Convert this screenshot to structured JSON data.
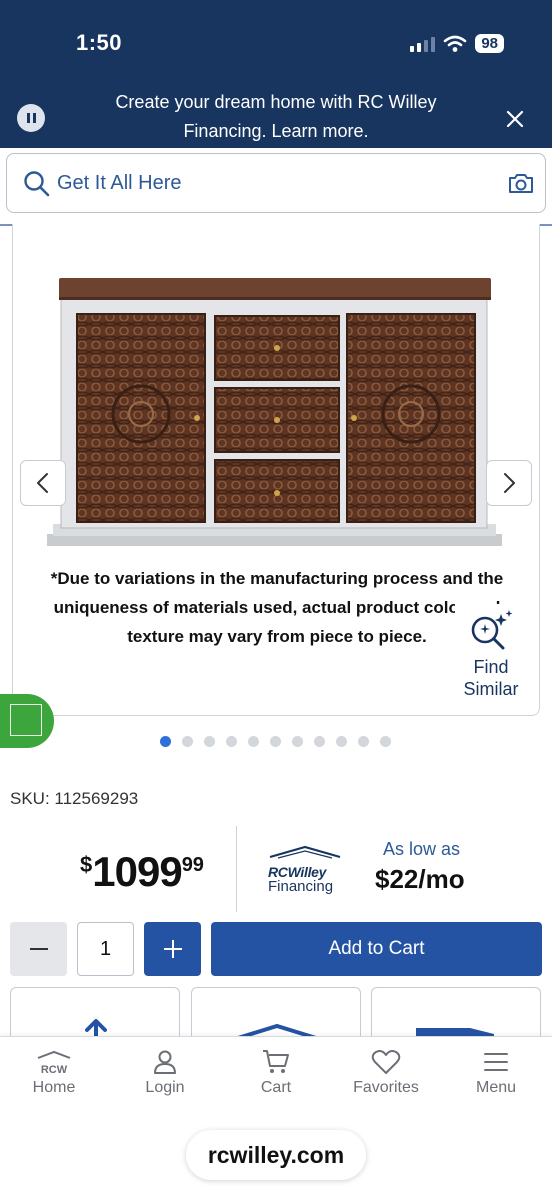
{
  "status_bar": {
    "time": "1:50",
    "battery": "98"
  },
  "banner": {
    "text": "Create your dream home with RC Willey Financing. Learn more."
  },
  "search": {
    "placeholder": "Get It All Here"
  },
  "product": {
    "disclaimer": "*Due to variations in the manufacturing process and the uniqueness of materials used, actual product color and texture may vary from piece to piece.",
    "find_similar_label": "Find Similar",
    "image_dots": {
      "count": 11,
      "active_index": 0
    },
    "sku": "SKU: 112569293",
    "price": {
      "currency": "$",
      "dollars": "1099",
      "cents": "99"
    },
    "financing": {
      "logo_line1": "RCWilley",
      "logo_line2": "Financing",
      "as_low_as": "As low as",
      "monthly": "$22/mo"
    },
    "quantity": "1",
    "add_to_cart_label": "Add to Cart"
  },
  "bottom_nav": [
    {
      "label": "Home",
      "icon": "rcw-home-icon"
    },
    {
      "label": "Login",
      "icon": "user-icon"
    },
    {
      "label": "Cart",
      "icon": "cart-icon"
    },
    {
      "label": "Favorites",
      "icon": "heart-icon"
    },
    {
      "label": "Menu",
      "icon": "menu-icon"
    }
  ],
  "browser": {
    "url": "rcwilley.com"
  },
  "colors": {
    "brand_navy": "#17355f",
    "button_blue": "#2553a3",
    "accent_green": "#3ca53c"
  }
}
